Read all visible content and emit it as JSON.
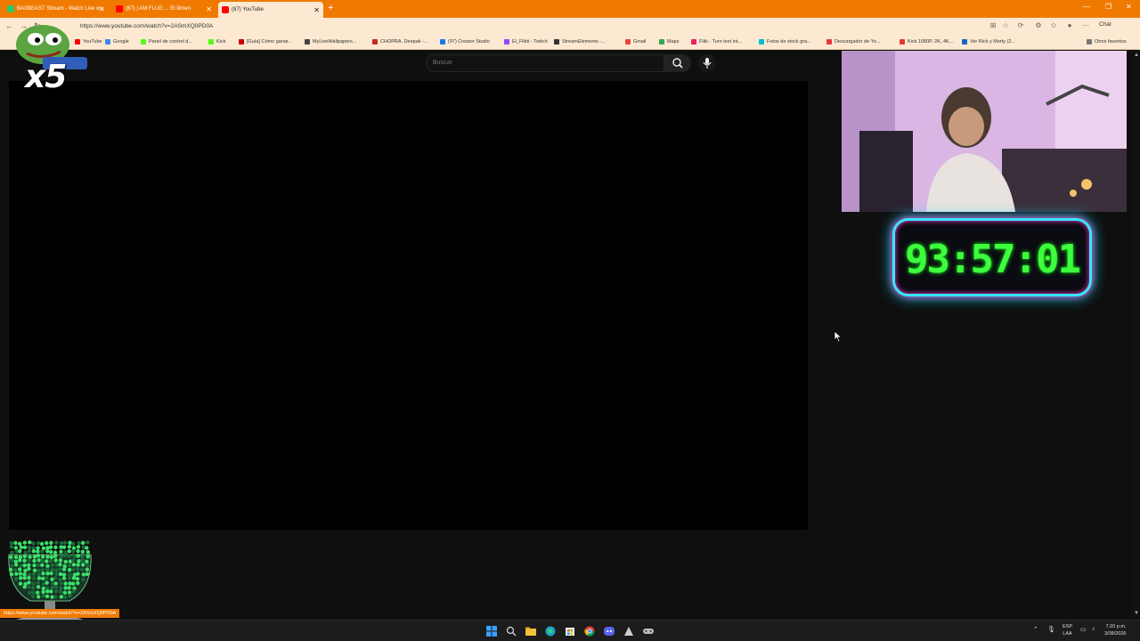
{
  "browser": {
    "tabs": [
      {
        "label": "BAXBEAST Stream - Watch Live on",
        "favicon_color": "#2ec866",
        "active": false
      },
      {
        "label": "(87) | AM FLUG ... El ilimen",
        "favicon_color": "#ff0000",
        "active": false
      },
      {
        "label": "(87) YouTube",
        "favicon_color": "#ff0000",
        "active": true
      }
    ],
    "new_tab_icon": "plus-icon",
    "url": "https://www.youtube.com/watch?v=2ASmXQ0PD0A",
    "chat_label": "Chat",
    "bookmarks": [
      {
        "label": "YouTube",
        "color": "#ff0000"
      },
      {
        "label": "Google",
        "color": "#4285f4"
      },
      {
        "label": "Panel de control d...",
        "color": "#53fc18"
      },
      {
        "label": "Kick",
        "color": "#53fc18"
      },
      {
        "label": "[Guía] Cómo ganar...",
        "color": "#cc0000"
      },
      {
        "label": "MyLiveWallpapers...",
        "color": "#444444"
      },
      {
        "label": "CHOPRA, Deepak -...",
        "color": "#c62828"
      },
      {
        "label": "(97) Creator Studio",
        "color": "#1877f2"
      },
      {
        "label": "El_Flikti - Twitch",
        "color": "#9146ff"
      },
      {
        "label": "StreamElements -...",
        "color": "#333333"
      },
      {
        "label": "Gmail",
        "color": "#ea4335"
      },
      {
        "label": "Maps",
        "color": "#34a853"
      },
      {
        "label": "Fliki - Turn text int...",
        "color": "#e91e63"
      },
      {
        "label": "Fotos de stock gra...",
        "color": "#00bcd4"
      },
      {
        "label": "Descargador de Yo...",
        "color": "#e53935"
      },
      {
        "label": "Kick 1080P, 2K, 4K...",
        "color": "#e53935"
      },
      {
        "label": "Ver Rick y Morty (2...",
        "color": "#1565c0"
      },
      {
        "label": "Otros favoritos",
        "color": "#777777"
      }
    ]
  },
  "youtube": {
    "search_placeholder": "Buscar",
    "search_icon": "search-icon",
    "mic_icon": "microphone-icon"
  },
  "overlay": {
    "multiplier": "x5",
    "timer": "93:57:01"
  },
  "status_url": "https://www.youtube.com/watch?v=2ASmXQ0PD0A",
  "taskbar": {
    "icons": [
      "windows-start-icon",
      "search-icon",
      "file-explorer-icon",
      "edge-icon",
      "store-icon",
      "chrome-icon",
      "discord-icon",
      "app-icon",
      "game-icon"
    ],
    "lang_line1": "ESP",
    "lang_line2": "LAA",
    "time": "7:20 p.m.",
    "date": "3/08/2026"
  },
  "colors": {
    "browser_frame": "#f07a00",
    "timer_digits": "#3dff3d",
    "timer_border": "#39e6ff",
    "timer_glow": "#ff3fcf"
  }
}
